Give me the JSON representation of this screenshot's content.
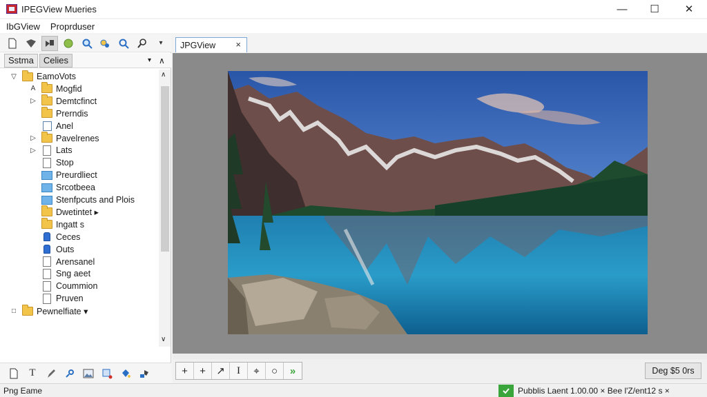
{
  "window": {
    "title": "IPEGView Mueries",
    "controls": {
      "minimize": "—",
      "maximize": "☐",
      "close": "✕"
    }
  },
  "menu": [
    "IbGView",
    "Proprduser"
  ],
  "left_panel": {
    "toolbar_icons": [
      "new-file-icon",
      "save-icon",
      "tools-icon",
      "globe-icon",
      "search-icon",
      "filter-icon",
      "zoom-icon",
      "find-icon",
      "dropdown-icon"
    ],
    "tabs": [
      {
        "label": "Sstma",
        "active": false
      },
      {
        "label": "Celies",
        "active": true
      }
    ],
    "tab_controls": {
      "menu": "▾",
      "collapse": "∧"
    },
    "tree": [
      {
        "label": "EamoVots",
        "arrow": "▽",
        "icon": "folder",
        "indent": 0
      },
      {
        "label": "Mogfid",
        "arrow": "A",
        "icon": "folder",
        "indent": 1
      },
      {
        "label": "Demtcfinct",
        "arrow": "▷",
        "icon": "folder",
        "indent": 1
      },
      {
        "label": "Prerndis",
        "arrow": "",
        "icon": "folder",
        "indent": 1
      },
      {
        "label": "Anel",
        "arrow": "",
        "icon": "image",
        "indent": 1
      },
      {
        "label": "Pavelrenes",
        "arrow": "▷",
        "icon": "folder",
        "indent": 1
      },
      {
        "label": "Lats",
        "arrow": "▷",
        "icon": "doc",
        "indent": 1
      },
      {
        "label": "Stop",
        "arrow": "",
        "icon": "doc",
        "indent": 1
      },
      {
        "label": "Preurdliect",
        "arrow": "",
        "icon": "blue",
        "indent": 1
      },
      {
        "label": "Srcotbeea",
        "arrow": "",
        "icon": "blue",
        "indent": 1
      },
      {
        "label": "Stenfpcuts and Plois",
        "arrow": "",
        "icon": "blue",
        "indent": 1
      },
      {
        "label": "Dwetintet ▸",
        "arrow": "",
        "icon": "folder",
        "indent": 1
      },
      {
        "label": "Ingatt s",
        "arrow": "",
        "icon": "folder",
        "indent": 1
      },
      {
        "label": "Ceces",
        "arrow": "",
        "icon": "lock",
        "indent": 1
      },
      {
        "label": "Outs",
        "arrow": "",
        "icon": "lock",
        "indent": 1
      },
      {
        "label": "Arensanel",
        "arrow": "",
        "icon": "doc",
        "indent": 1
      },
      {
        "label": "Sng aeet",
        "arrow": "",
        "icon": "doc",
        "indent": 1
      },
      {
        "label": "Coummion",
        "arrow": "",
        "icon": "doc",
        "indent": 1
      },
      {
        "label": "Pruven",
        "arrow": "",
        "icon": "doc",
        "indent": 1
      },
      {
        "label": "Pewnelfiate ▾",
        "arrow": "□",
        "icon": "folder",
        "indent": 0
      }
    ],
    "bottom_tools": [
      "page-icon",
      "text-icon",
      "pen-icon",
      "brush-icon",
      "image-icon",
      "crop-icon",
      "bucket-icon",
      "stamp-icon"
    ]
  },
  "document": {
    "tab_label": "JPGView",
    "tab_close": "×"
  },
  "image_tools": [
    "+",
    "+",
    "↗",
    "I",
    "⌖",
    "○",
    "»"
  ],
  "display_button": "Deg $5 0rs",
  "status": {
    "left": "Png  Eame",
    "right": "Pubblis Laent  1.00.00 ×  Bee l'Z/ent12 s ×"
  },
  "colors": {
    "accent": "#7aa7d8",
    "status_ok": "#3aa53a",
    "folder": "#f2c54a"
  }
}
